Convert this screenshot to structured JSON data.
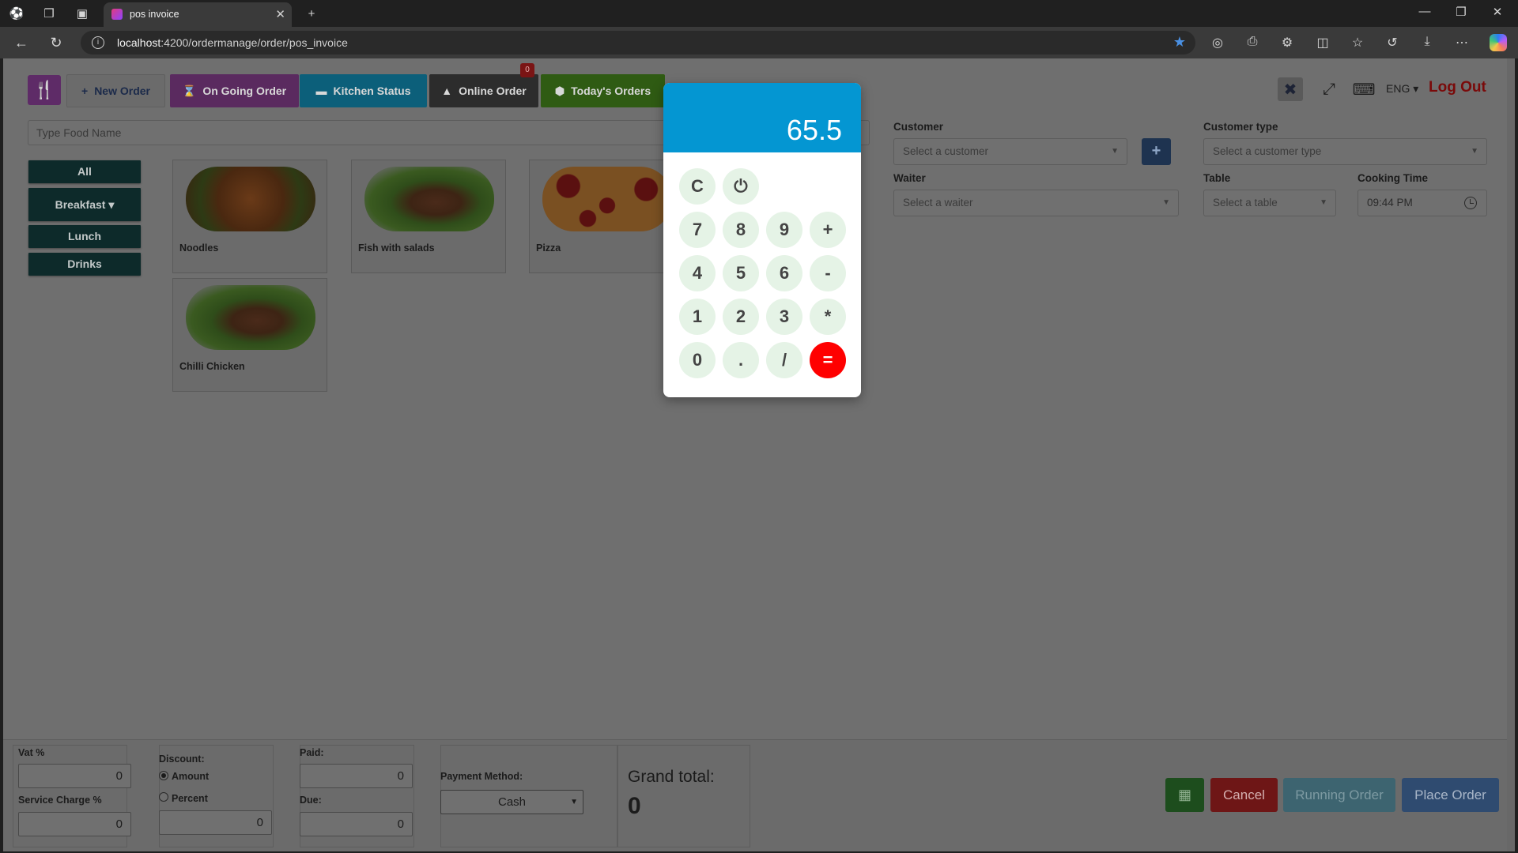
{
  "browser": {
    "tab_title": "pos invoice",
    "url_host": "localhost",
    "url_path": ":4200/ordermanage/order/pos_invoice"
  },
  "nav": {
    "new_order": "New Order",
    "ongoing_order": "On Going Order",
    "kitchen_status": "Kitchen Status",
    "online_order": "Online Order",
    "online_badge": "0",
    "todays_orders": "Today's Orders"
  },
  "header": {
    "language": "ENG",
    "logout": "Log Out"
  },
  "search": {
    "placeholder": "Type Food Name"
  },
  "categories": [
    "All",
    "Breakfast",
    "Lunch",
    "Drinks"
  ],
  "foods": [
    {
      "name": "Noodles",
      "image": "noodles"
    },
    {
      "name": "Fish with salads",
      "image": "salad"
    },
    {
      "name": "Pizza",
      "image": "pizza"
    },
    {
      "name": "Chilli Chicken",
      "image": "salad"
    }
  ],
  "form": {
    "customer_label": "Customer",
    "customer_placeholder": "Select a customer",
    "customer_type_label": "Customer type",
    "customer_type_placeholder": "Select a customer type",
    "waiter_label": "Waiter",
    "waiter_placeholder": "Select a waiter",
    "table_label": "Table",
    "table_placeholder": "Select a table",
    "cooking_time_label": "Cooking Time",
    "cooking_time_value": "09:44 PM"
  },
  "calculator": {
    "display": "65.5",
    "keys": [
      "C",
      "⏻",
      "7",
      "8",
      "9",
      "+",
      "4",
      "5",
      "6",
      "-",
      "1",
      "2",
      "3",
      "*",
      "0",
      ".",
      "/",
      "="
    ]
  },
  "footer": {
    "vat_label": "Vat %",
    "vat_value": "0",
    "service_label": "Service Charge %",
    "service_value": "0",
    "discount_label": "Discount:",
    "amount_label": "Amount",
    "percent_label": "Percent",
    "discount_value": "0",
    "paid_label": "Paid:",
    "paid_value": "0",
    "due_label": "Due:",
    "due_value": "0",
    "payment_method_label": "Payment Method:",
    "payment_method_value": "Cash",
    "grand_total_label": "Grand total:",
    "grand_total_value": "0",
    "cancel": "Cancel",
    "running_order": "Running Order",
    "place_order": "Place Order"
  }
}
